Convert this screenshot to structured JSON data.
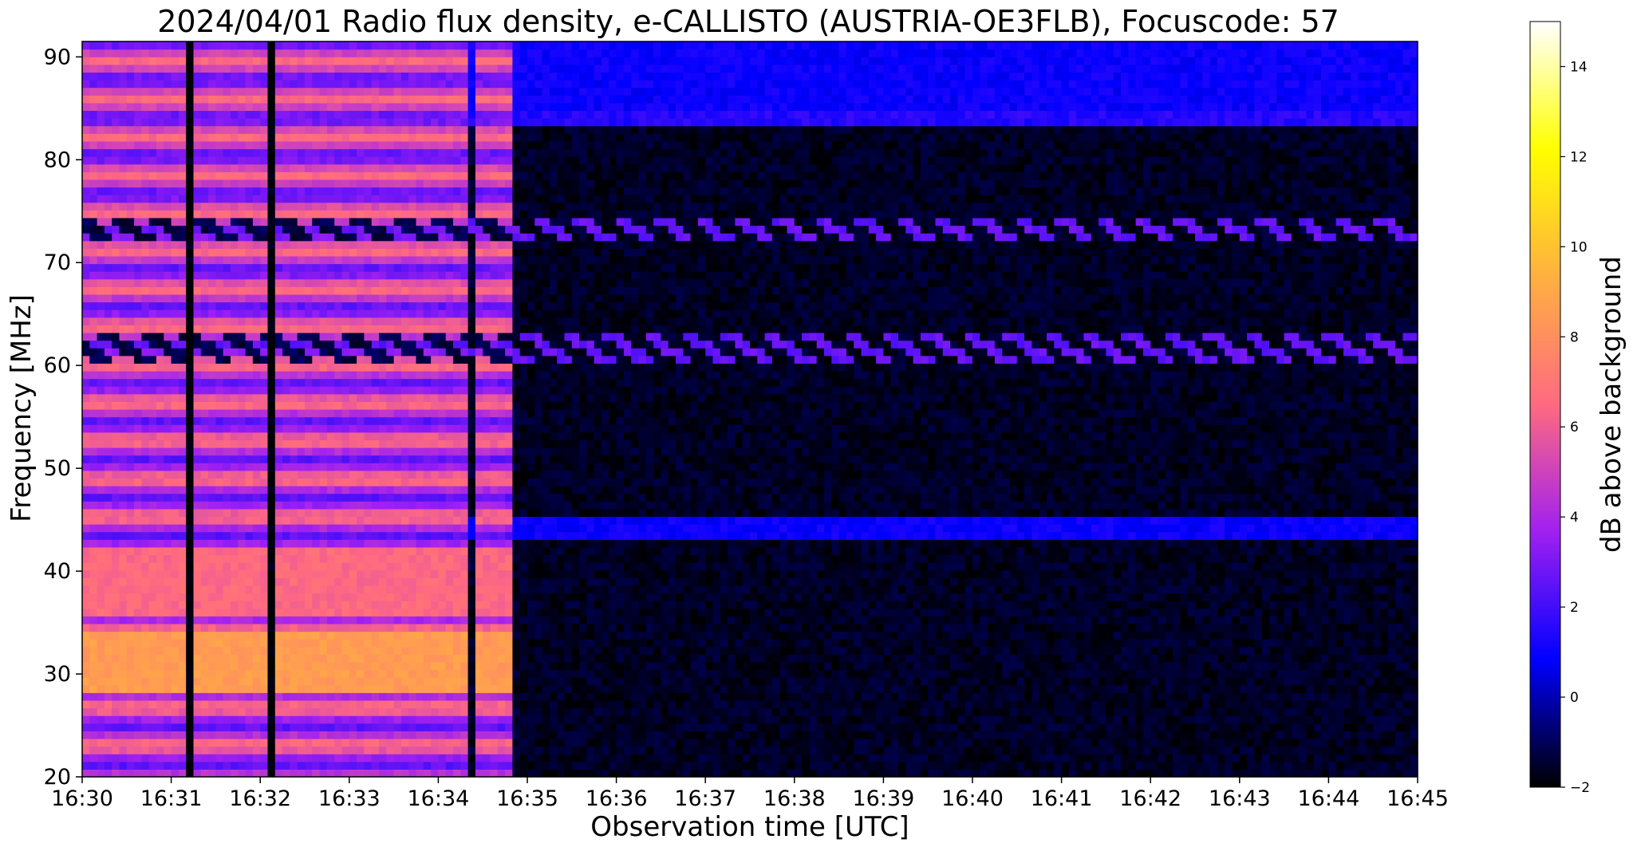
{
  "chart_data": {
    "type": "heatmap",
    "title": "2024/04/01  Radio flux density, e-CALLISTO (AUSTRIA-OE3FLB), Focuscode: 57",
    "xlabel": "Observation time [UTC]",
    "ylabel": "Frequency [MHz]",
    "colorbar_label": "dB above background",
    "x_ticks": [
      "16:30",
      "16:31",
      "16:32",
      "16:33",
      "16:34",
      "16:35",
      "16:36",
      "16:37",
      "16:38",
      "16:39",
      "16:40",
      "16:41",
      "16:42",
      "16:43",
      "16:44",
      "16:45"
    ],
    "xlim": [
      "16:30",
      "16:45"
    ],
    "y_ticks": [
      20,
      30,
      40,
      50,
      60,
      70,
      80,
      90
    ],
    "ylim": [
      20,
      91.5
    ],
    "colorbar_ticks": [
      -2,
      0,
      2,
      4,
      6,
      8,
      10,
      12,
      14
    ],
    "clim": [
      -2,
      15
    ],
    "colormap": "gnuplot2",
    "colormap_stops": [
      "#000000",
      "#0000ff",
      "#a020f0",
      "#ff6a80",
      "#ffb040",
      "#ffff00",
      "#ffffff"
    ],
    "segments": [
      {
        "start": "16:30:00",
        "end": "16:34:18",
        "level": "elevated",
        "dB_range": [
          3,
          9
        ]
      },
      {
        "start": "16:34:18",
        "end": "16:34:27",
        "level": "background",
        "dB_range": [
          -2,
          0
        ]
      },
      {
        "start": "16:34:27",
        "end": "16:34:48",
        "level": "elevated",
        "dB_range": [
          3,
          9
        ]
      },
      {
        "start": "16:34:48",
        "end": "16:45:00",
        "level": "background",
        "dB_range": [
          -2,
          1
        ]
      }
    ],
    "features": [
      {
        "kind": "band",
        "freq_range": [
          28.5,
          34
        ],
        "dB": 8.5,
        "time_range": [
          "16:30",
          "16:34:48"
        ]
      },
      {
        "kind": "band",
        "freq_range": [
          35.5,
          42
        ],
        "dB": 6.5,
        "time_range": [
          "16:30",
          "16:34:48"
        ]
      },
      {
        "kind": "band",
        "freq_range": [
          83,
          85
        ],
        "dB": 1.5,
        "time_range": [
          "16:30",
          "16:45"
        ]
      },
      {
        "kind": "band",
        "freq_range": [
          85,
          91.5
        ],
        "dB": 1,
        "time_range": [
          "16:30",
          "16:45"
        ]
      },
      {
        "kind": "band",
        "freq_range": [
          43,
          45.5
        ],
        "dB": 1,
        "time_range": [
          "16:30",
          "16:45"
        ]
      },
      {
        "kind": "periodic_streaks",
        "freq_range": [
          72,
          74
        ],
        "dB": 2,
        "time_range": [
          "16:30",
          "16:45"
        ]
      },
      {
        "kind": "periodic_streaks",
        "freq_range": [
          60,
          63
        ],
        "dB": 2,
        "time_range": [
          "16:30",
          "16:45"
        ]
      },
      {
        "kind": "vertical_dropouts",
        "times": [
          "16:31:13",
          "16:31:20",
          "16:32:08",
          "16:32:25"
        ]
      }
    ]
  }
}
